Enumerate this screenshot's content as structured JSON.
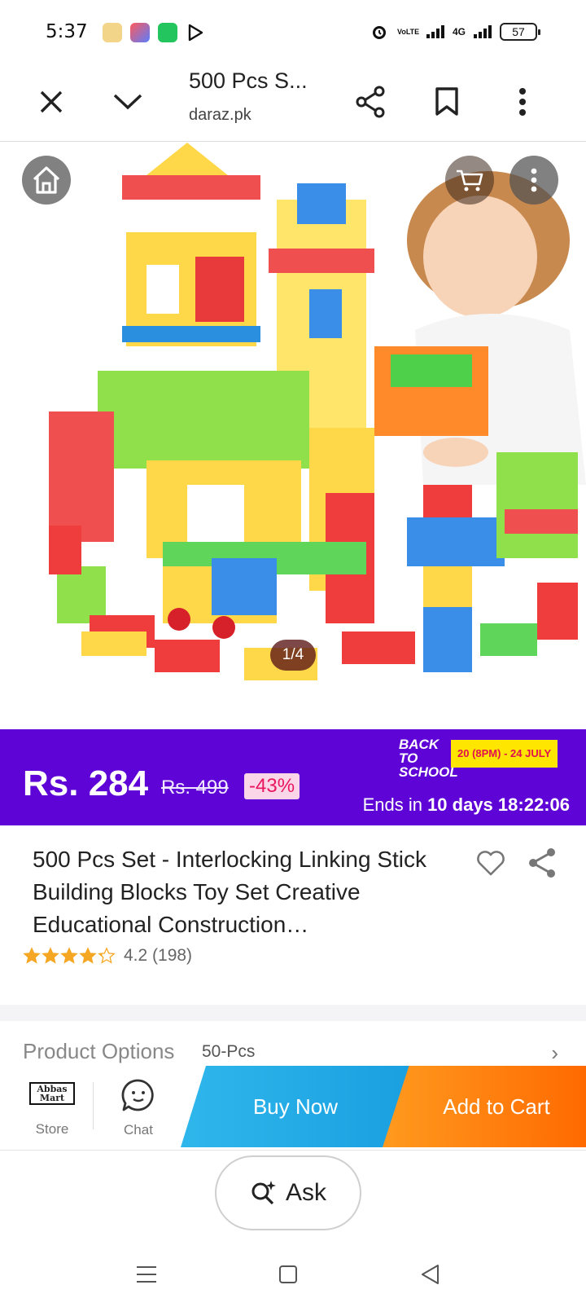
{
  "status_bar": {
    "time": "5:37",
    "volte_label": "VoLTE",
    "network": "4G",
    "battery": "57"
  },
  "browser": {
    "title": "500 Pcs S...",
    "domain": "daraz.pk"
  },
  "gallery": {
    "counter": "1/4"
  },
  "price_banner": {
    "price": "Rs. 284",
    "original_price": "Rs. 499",
    "discount": "-43%",
    "campaign_line1": "BACK TO",
    "campaign_line2": "SCHOOL",
    "campaign_dates": "20 (8PM) - 24 JULY",
    "ends_prefix": "Ends in ",
    "ends_days": "10 days",
    "ends_time": "18:22:06"
  },
  "product": {
    "title": "500 Pcs Set - Interlocking Linking Stick Building Blocks Toy Set Creative Educational Construction…",
    "rating_stars": 4.2,
    "rating_text": "4.2 (198)"
  },
  "options": {
    "label": "Product Options",
    "value": "50-Pcs"
  },
  "action_bar": {
    "store_logo_line1": "Abbas",
    "store_logo_line2": "Mart",
    "store_label": "Store",
    "chat_label": "Chat",
    "buy_now": "Buy Now",
    "add_to_cart": "Add to Cart"
  },
  "ask": {
    "label": "Ask"
  },
  "colors": {
    "price_banner": "#5f04d6",
    "buy_now": "#1a9fe0",
    "add_to_cart": "#ff6a00",
    "discount_text": "#e8175d",
    "star": "#f5a623"
  }
}
